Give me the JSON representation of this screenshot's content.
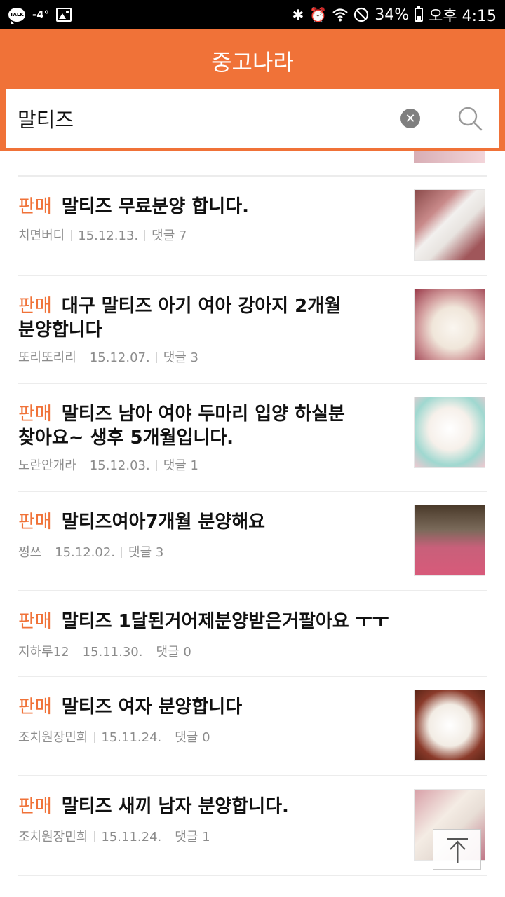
{
  "status_bar": {
    "talk": "TALK",
    "temperature": "-4°",
    "battery": "34%",
    "time": "오후 4:15",
    "battery_level": 0.34
  },
  "header": {
    "title": "중고나라",
    "background": "#f07238"
  },
  "search": {
    "query": "말티즈"
  },
  "items": [
    {
      "tag": "판매",
      "title": "말티즈 무료분양 합니다.",
      "author": "치면버디",
      "date": "15.12.13.",
      "comments": "댓글 7",
      "thumb": "dog-photo"
    },
    {
      "tag": "판매",
      "title": "대구 말티즈 아기 여아 강아지 2개월 분양합니다",
      "author": "또리또리리",
      "date": "15.12.07.",
      "comments": "댓글 3",
      "thumb": "dog-photo"
    },
    {
      "tag": "판매",
      "title": "말티즈 남아 여야 두마리 입양 하실분 찾아요~ 생후 5개월입니다.",
      "author": "노란안개라",
      "date": "15.12.03.",
      "comments": "댓글 1",
      "thumb": "dog-photo"
    },
    {
      "tag": "판매",
      "title": "말티즈여아7개월 분양해요",
      "author": "쩡쓰",
      "date": "15.12.02.",
      "comments": "댓글 3",
      "thumb": "dog-photo"
    },
    {
      "tag": "판매",
      "title": "말티즈 1달된거어제분양받은거팔아요 ㅜㅜ",
      "author": "지하루12",
      "date": "15.11.30.",
      "comments": "댓글 0",
      "thumb": ""
    },
    {
      "tag": "판매",
      "title": "말티즈 여자 분양합니다",
      "author": "조치원장민희",
      "date": "15.11.24.",
      "comments": "댓글 0",
      "thumb": "dog-photo"
    },
    {
      "tag": "판매",
      "title": "말티즈 새끼 남자 분양합니다.",
      "author": "조치원장민희",
      "date": "15.11.24.",
      "comments": "댓글 1",
      "thumb": "dog-photo"
    }
  ]
}
